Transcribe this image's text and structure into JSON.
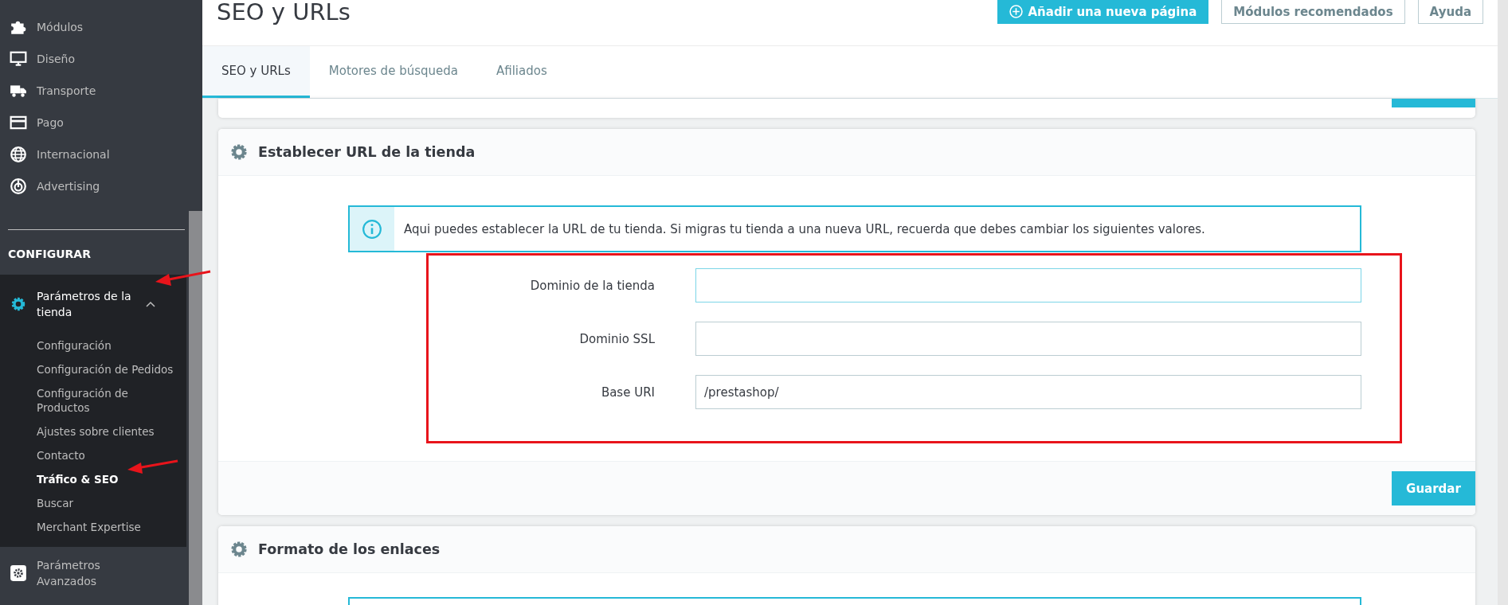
{
  "sidebar": {
    "items": [
      {
        "label": "Módulos"
      },
      {
        "label": "Diseño"
      },
      {
        "label": "Transporte"
      },
      {
        "label": "Pago"
      },
      {
        "label": "Internacional"
      },
      {
        "label": "Advertising"
      }
    ],
    "section_title": "CONFIGURAR",
    "groups": [
      {
        "label": "Parámetros de la tienda",
        "expanded": true,
        "children": [
          {
            "label": "Configuración",
            "selected": false
          },
          {
            "label": "Configuración de Pedidos",
            "selected": false
          },
          {
            "label": "Configuración de Productos",
            "selected": false
          },
          {
            "label": "Ajustes sobre clientes",
            "selected": false
          },
          {
            "label": "Contacto",
            "selected": false
          },
          {
            "label": "Tráfico & SEO",
            "selected": true
          },
          {
            "label": "Buscar",
            "selected": false
          },
          {
            "label": "Merchant Expertise",
            "selected": false
          }
        ]
      },
      {
        "label": "Parámetros Avanzados",
        "expanded": false
      }
    ]
  },
  "header": {
    "title": "SEO y URLs",
    "buttons": [
      {
        "label": "Añadir una nueva página",
        "kind": "primary"
      },
      {
        "label": "Módulos recomendados",
        "kind": "default"
      },
      {
        "label": "Ayuda",
        "kind": "default"
      }
    ]
  },
  "tabs": [
    {
      "label": "SEO y URLs",
      "selected": true
    },
    {
      "label": "Motores de búsqueda",
      "selected": false
    },
    {
      "label": "Afiliados",
      "selected": false
    }
  ],
  "panels": [
    {
      "title": "Establecer URL de la tienda",
      "info": "Aqui puedes establecer la URL de tu tienda. Si migras tu tienda a una nueva URL, recuerda que debes cambiar los siguientes valores.",
      "fields": [
        {
          "label": "Dominio de la tienda",
          "focused": true
        },
        {
          "label": "Dominio SSL",
          "focused": false
        },
        {
          "label": "Base URI",
          "value": "/prestashop/",
          "focused": false
        }
      ],
      "save_button": "Guardar"
    },
    {
      "title": "Formato de los enlaces"
    }
  ]
}
